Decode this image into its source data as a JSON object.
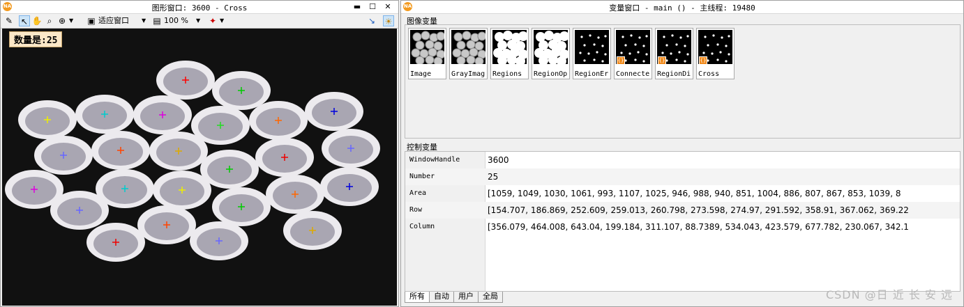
{
  "graphics_window": {
    "title": "图形窗口: 3600 - Cross",
    "app_icon": "NA",
    "toolbar": {
      "fit_label": "适应窗口",
      "zoom_label": "100 %"
    },
    "count_text": "数量是:25"
  },
  "variable_window": {
    "title": "变量窗口 - main () - 主线程: 19480",
    "app_icon": "NA",
    "image_vars_label": "图像变量",
    "image_vars": [
      {
        "name": "Image",
        "kind": "gray"
      },
      {
        "name": "GrayImag",
        "kind": "gray"
      },
      {
        "name": "Regions",
        "kind": "white"
      },
      {
        "name": "RegionOp",
        "kind": "white"
      },
      {
        "name": "RegionEr",
        "kind": "dots"
      },
      {
        "name": "Connecte",
        "kind": "dots",
        "badge": true
      },
      {
        "name": "RegionDi",
        "kind": "dots",
        "badge": true
      },
      {
        "name": "Cross",
        "kind": "dots",
        "badge": true
      }
    ],
    "control_vars_label": "控制变量",
    "control_vars": [
      {
        "name": "WindowHandle",
        "value": "3600"
      },
      {
        "name": "Number",
        "value": "25"
      },
      {
        "name": "Area",
        "value": "[1059, 1049, 1030, 1061, 993, 1107, 1025, 946, 988, 940, 851, 1004, 886, 807, 867, 853, 1039, 8"
      },
      {
        "name": "Row",
        "value": "[154.707, 186.869, 252.609, 259.013, 260.798, 273.598, 274.97, 291.592, 358.91, 367.062, 369.22"
      },
      {
        "name": "Column",
        "value": "[356.079, 464.008, 643.04, 199.184, 311.107, 88.7389, 534.043, 423.579, 677.782, 230.067, 342.1"
      }
    ],
    "tabs": [
      "所有",
      "自动",
      "用户",
      "全局"
    ]
  },
  "watermark": "CSDN @日 近 长 安 远"
}
